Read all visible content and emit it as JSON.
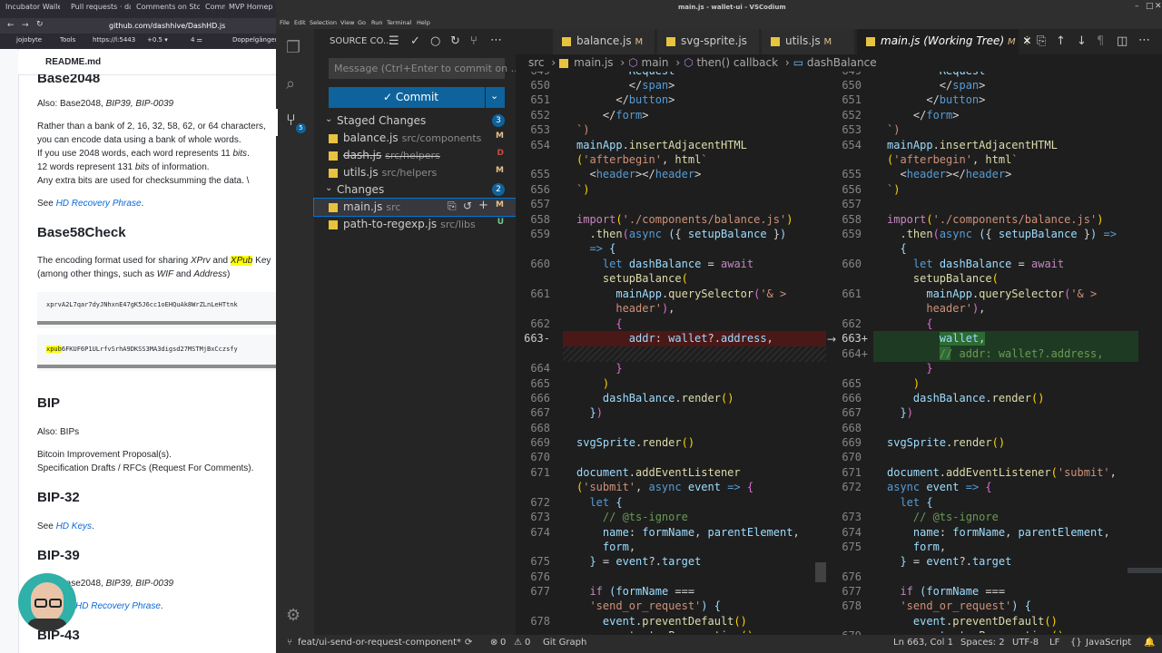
{
  "browser": {
    "tabs": [
      "Incubator Wallet",
      "Pull requests · da",
      "Comments on Sto",
      "Comments on Sta",
      "MVP Homep"
    ],
    "url": "github.com/dashhive/DashHD.js",
    "bookmarks": [
      "jojobyte",
      "Tools",
      "https://l:5443",
      "+0.5 ▾",
      "4 ⚌",
      "Doppelgänger"
    ],
    "readme_title": "README.md",
    "heading_partial": "Base2048",
    "also_base2048": "Also: Base2048, ",
    "also_base2048_it": "BIP39, BIP-0039",
    "para1_l1": "Rather than a bank of 2, 16, 32, 58, 62, or 64 characters,",
    "para1_l2": "you can encode data using a bank of whole words.",
    "para1_l3a": "If you use 2048 words, each word represents 11 ",
    "para1_l3b": "bits",
    "para1_l3c": ".",
    "para1_l4a": "12 words represent 131 ",
    "para1_l4b": "bits",
    "para1_l4c": " of information.",
    "para1_l5": "Any extra bits are used for checksumming the data. \\",
    "see1": "See ",
    "see1_link": "HD Recovery Phrase",
    "see1_end": ".",
    "h_base58check": "Base58Check",
    "b58_l1a": "The encoding format used for sharing ",
    "b58_l1b": "XPrv",
    "b58_l1c": " and ",
    "b58_l1d": "XPub",
    "b58_l1e": " Key",
    "b58_l2a": "(among other things, such as ",
    "b58_l2b": "WIF",
    "b58_l2c": " and ",
    "b58_l2d": "Address",
    "b58_l2e": ")",
    "code1": "xprvA2L7qar7dyJNhxnE47gK5J6cc1oEHQuAk8WrZLnLeHTtnk",
    "code2a": "xpub",
    "code2b": "6FKUF6P1ULrfvSrhA9DKSS3MA3digsd27MSTMjBxCczsfy",
    "h_bip": "BIP",
    "also_bips": "Also: BIPs",
    "bip_l1": "Bitcoin Improvement Proposal(s).",
    "bip_l2": "Specification Drafts / RFCs (Request For Comments).",
    "h_bip32": "BIP-32",
    "see2": "See ",
    "see2_link": "HD Keys",
    "see2_end": ".",
    "h_bip39": "BIP-39",
    "also_bip39a": "Also: Base2048, ",
    "also_bip39b": "BIP39, BIP-0039",
    "see3_link": "HD Recovery Phrase",
    "see3_end": ".",
    "h_bip43": "BIP-43"
  },
  "vscode": {
    "window_title": "main.js - wallet-ui - VSCodium",
    "menu": [
      "File",
      "Edit",
      "Selection",
      "View",
      "Go",
      "Run",
      "Terminal",
      "Help"
    ],
    "scm": {
      "title": "SOURCE CO...",
      "message_placeholder": "Message (Ctrl+Enter to commit on ...",
      "commit_label": "✓ Commit",
      "staged_label": "Staged Changes",
      "staged_count": "3",
      "changes_label": "Changes",
      "changes_count": "2",
      "activity_badge": "5",
      "staged": [
        {
          "name": "balance.js",
          "path": "src/components",
          "status": "M"
        },
        {
          "name": "dash.js",
          "path": "src/helpers",
          "status": "D"
        },
        {
          "name": "utils.js",
          "path": "src/helpers",
          "status": "M"
        }
      ],
      "changes": [
        {
          "name": "main.js",
          "path": "src",
          "status": "M"
        },
        {
          "name": "path-to-regexp.js",
          "path": "src/libs",
          "status": "U"
        }
      ]
    },
    "tabs": [
      {
        "label": "balance.js",
        "status": "M"
      },
      {
        "label": "svg-sprite.js",
        "status": ""
      },
      {
        "label": "utils.js",
        "status": "M"
      },
      {
        "label": "main.js (Working Tree)",
        "status": "M"
      }
    ],
    "breadcrumb": [
      "src",
      "main.js",
      "main",
      "then() callback",
      "dashBalance"
    ],
    "status": {
      "branch": "feat/ui-send-or-request-component*",
      "errors": "0",
      "warnings": "0",
      "git_graph": "Git Graph",
      "position": "Ln 663, Col 1",
      "spaces": "Spaces: 2",
      "encoding": "UTF-8",
      "eol": "LF",
      "language": "JavaScript"
    },
    "left_lines": [
      "649",
      "650",
      "651",
      "652",
      "653",
      "654",
      "",
      "655",
      "656",
      "657",
      "658",
      "659",
      "",
      "660",
      "",
      "661",
      "",
      "662",
      "663",
      "",
      "664",
      "665",
      "666",
      "667",
      "668",
      "669",
      "670",
      "671",
      "",
      "672",
      "673",
      "674",
      "",
      "675",
      "676",
      "677",
      "",
      "678"
    ],
    "right_lines": [
      "649",
      "650",
      "651",
      "652",
      "653",
      "654",
      "",
      "655",
      "656",
      "657",
      "658",
      "659",
      "",
      "660",
      "",
      "661",
      "",
      "662",
      "663",
      "664",
      "",
      "665",
      "666",
      "667",
      "668",
      "669",
      "670",
      "671",
      "672",
      "",
      "673",
      "674",
      "675",
      "",
      "676",
      "677",
      "678",
      "",
      "679"
    ],
    "change_markers": {
      "left_deleted": "663-",
      "right_added_1": "663+",
      "right_added_2": "664+"
    }
  }
}
